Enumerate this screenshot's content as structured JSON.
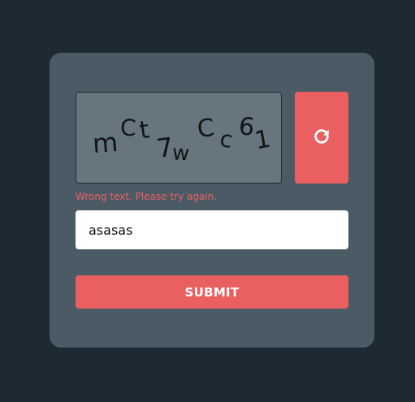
{
  "captcha": {
    "characters": [
      "m",
      "C",
      "t",
      "7",
      "w",
      "C",
      "c",
      "6",
      "1"
    ]
  },
  "refresh": {
    "icon": "refresh-icon"
  },
  "error": {
    "message": "Wrong text. Please try again."
  },
  "input": {
    "value": "asasas"
  },
  "submit": {
    "label": "SUBMIT"
  },
  "colors": {
    "page_background": "#1e2a33",
    "card_background": "#4b5b66",
    "captcha_background": "#66757e",
    "accent": "#ea6060",
    "input_background": "#ffffff"
  }
}
